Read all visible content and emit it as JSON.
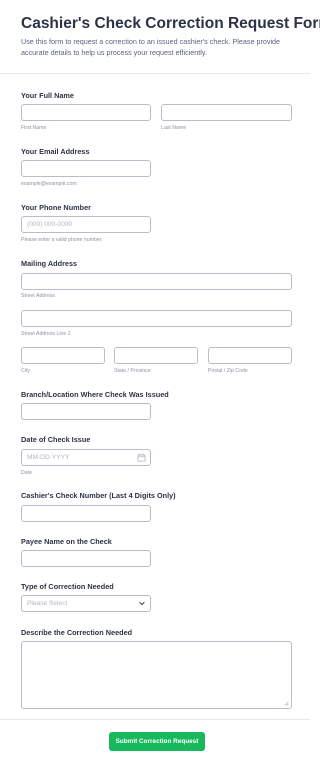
{
  "header": {
    "title": "Cashier's Check Correction Request Form",
    "description": "Use this form to request a correction to an issued cashier's check. Please provide accurate details to help us process your request efficiently."
  },
  "fields": {
    "full_name": {
      "label": "Your Full Name",
      "first_sub": "First Name",
      "last_sub": "Last Name"
    },
    "email": {
      "label": "Your Email Address",
      "sub": "example@example.com"
    },
    "phone": {
      "label": "Your Phone Number",
      "placeholder": "(000) 000-0000",
      "sub": "Please enter a valid phone number."
    },
    "address": {
      "label": "Mailing Address",
      "street_sub": "Street Address",
      "street2_sub": "Street Address Line 2",
      "city_sub": "City",
      "state_sub": "State / Province",
      "zip_sub": "Postal / Zip Code"
    },
    "branch": {
      "label": "Branch/Location Where Check Was Issued"
    },
    "date": {
      "label": "Date of Check Issue",
      "placeholder": "MM-DD-YYYY",
      "sub": "Date",
      "icon": "calendar-icon"
    },
    "check_number": {
      "label": "Cashier's Check Number (Last 4 Digits Only)"
    },
    "payee": {
      "label": "Payee Name on the Check"
    },
    "correction_type": {
      "label": "Type of Correction Needed",
      "selected": "Please Select",
      "icon": "chevron-down-icon"
    },
    "description": {
      "label": "Describe the Correction Needed"
    }
  },
  "submit": {
    "label": "Submit Correction Request"
  },
  "colors": {
    "accent": "#18b85c",
    "text": "#2c3345",
    "border": "#b8bdc9"
  }
}
